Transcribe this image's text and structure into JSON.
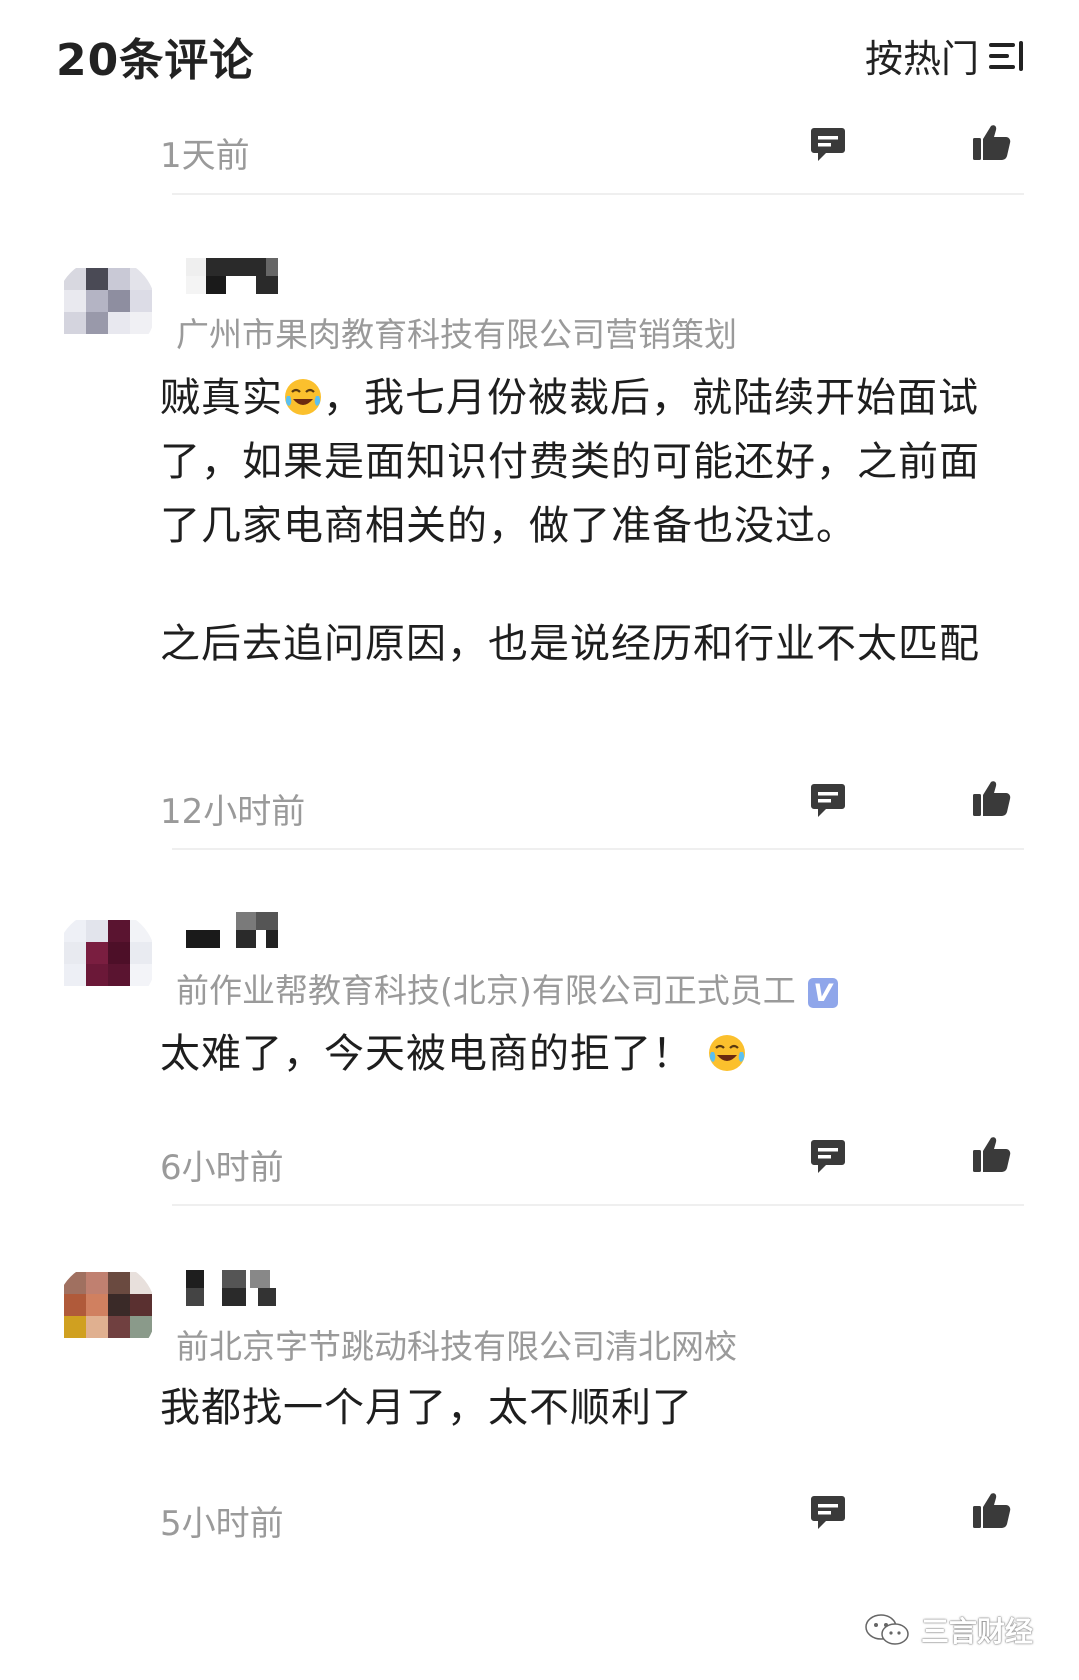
{
  "header": {
    "title": "20条评论",
    "sort_label": "按热门"
  },
  "top_meta": {
    "time": "1天前"
  },
  "comments": [
    {
      "company": "广州市果肉教育科技有限公司营销策划",
      "paragraph1_before_emoji": "贼真实",
      "paragraph1_after_emoji": "，我七月份被裁后，就陆续开始面试了，如果是面知识付费类的可能还好，之前面了几家电商相关的，做了准备也没过。",
      "paragraph2": "之后去追问原因，也是说经历和行业不太匹配",
      "time": "12小时前",
      "emoji_icon": "tears-of-joy-emoji"
    },
    {
      "company": "前作业帮教育科技(北京)有限公司正式员工",
      "verified_badge": "V",
      "text": "太难了，今天被电商的拒了！",
      "time": "6小时前",
      "emoji_icon": "tears-of-joy-emoji"
    },
    {
      "company": "前北京字节跳动科技有限公司清北网校",
      "text": "我都找一个月了，太不顺利了",
      "time": "5小时前"
    }
  ],
  "watermark": {
    "text": "三言财经",
    "icon": "wechat-icon"
  },
  "icons": {
    "reply": "reply-icon",
    "like": "thumbs-up-icon",
    "sort": "sort-icon"
  },
  "colors": {
    "meta_gray": "#9a9a9a",
    "icon_gray": "#3a3a3a",
    "verified_blue": "#8fa6ea"
  }
}
